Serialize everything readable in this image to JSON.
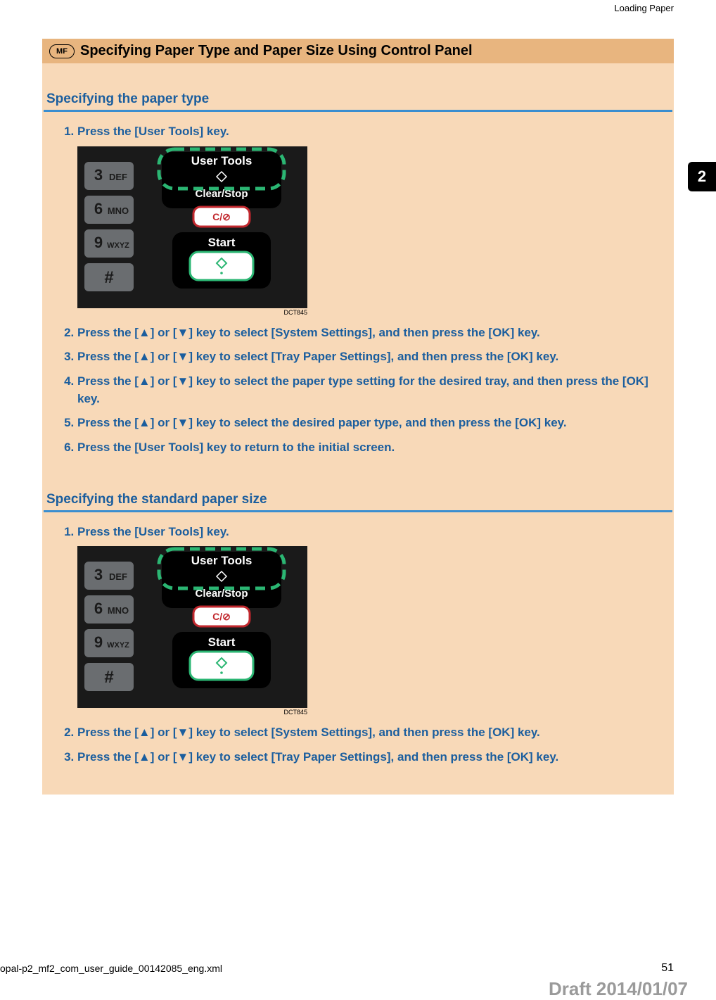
{
  "running_head": "Loading Paper",
  "chapter_tab": "2",
  "title": {
    "badge": "MF",
    "text": "Specifying Paper Type and Paper Size Using Control Panel"
  },
  "panel_graphic": {
    "labels": {
      "user_tools": "User Tools",
      "clear_stop": "Clear/Stop",
      "start": "Start"
    },
    "keys": [
      {
        "digit": "3",
        "letters": "DEF"
      },
      {
        "digit": "6",
        "letters": "MNO"
      },
      {
        "digit": "9",
        "letters": "WXYZ"
      },
      {
        "digit": "#",
        "letters": ""
      }
    ],
    "code": "DCT845"
  },
  "section_type": {
    "heading": "Specifying the paper type",
    "steps": [
      "Press the [User Tools] key.",
      "Press the [▲] or [▼] key to select [System Settings], and then press the [OK] key.",
      "Press the [▲] or [▼] key to select [Tray Paper Settings], and then press the [OK] key.",
      "Press the [▲] or [▼] key to select the paper type setting for the desired tray, and then press the [OK] key.",
      "Press the [▲] or [▼] key to select the desired paper type, and then press the [OK] key.",
      "Press the [User Tools] key to return to the initial screen."
    ]
  },
  "section_size": {
    "heading": "Specifying the standard paper size",
    "steps": [
      "Press the [User Tools] key.",
      "Press the [▲] or [▼] key to select [System Settings], and then press the [OK] key.",
      "Press the [▲] or [▼] key to select [Tray Paper Settings], and then press the [OK] key."
    ]
  },
  "footer": {
    "filename": "opal-p2_mf2_com_user_guide_00142085_eng.xml",
    "page": "51",
    "draft": "Draft 2014/01/07"
  }
}
